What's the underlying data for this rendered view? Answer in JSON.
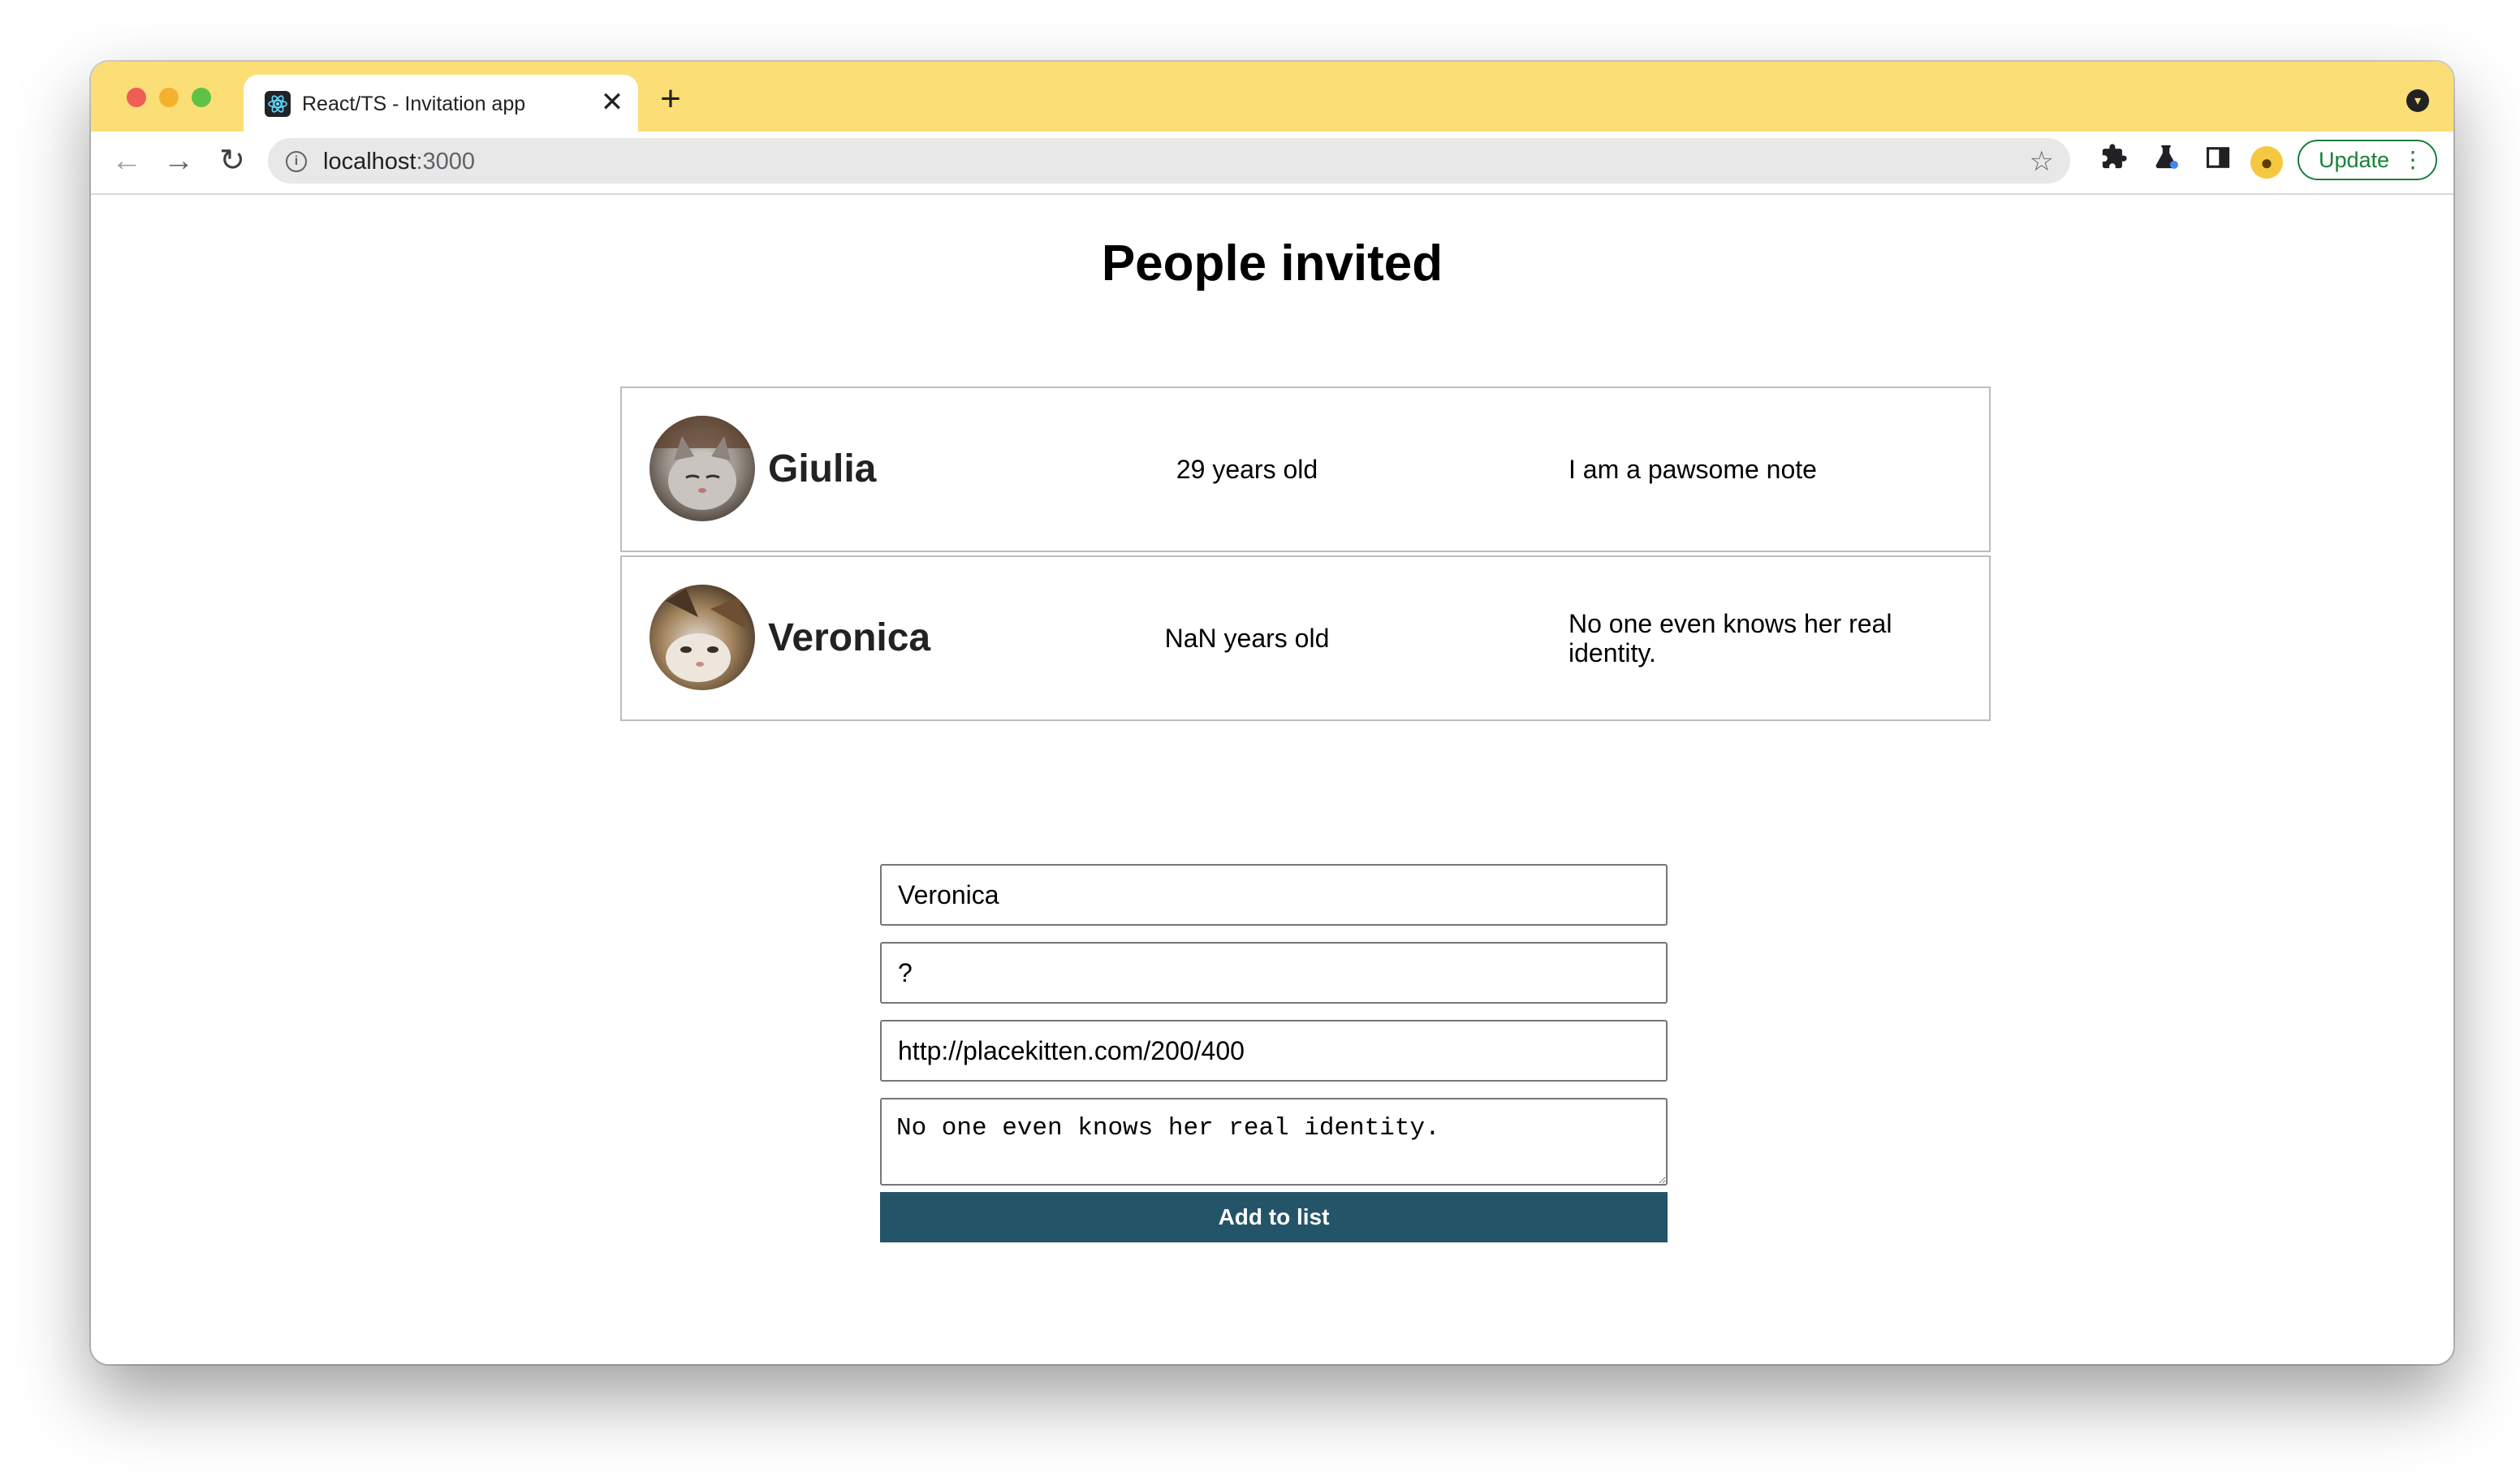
{
  "browser": {
    "tab_title": "React/TS - Invitation app",
    "tab_close": "✕",
    "new_tab": "+",
    "url_host": "localhost",
    "url_port": ":3000",
    "update_label": "Update",
    "accent_color": "#fcde76"
  },
  "page": {
    "title": "People invited"
  },
  "people": [
    {
      "name": "Giulia",
      "age": "29 years old",
      "note": "I am a pawsome note",
      "avatar": "kitten-photo"
    },
    {
      "name": "Veronica",
      "age": "NaN years old",
      "note": "No one even knows her real identity.",
      "avatar": "kitten-photo"
    }
  ],
  "form": {
    "name_value": "Veronica",
    "age_value": "?",
    "url_value": "http://placekitten.com/200/400",
    "note_value": "No one even knows her real identity.",
    "submit_label": "Add to list",
    "submit_color": "#245468"
  }
}
